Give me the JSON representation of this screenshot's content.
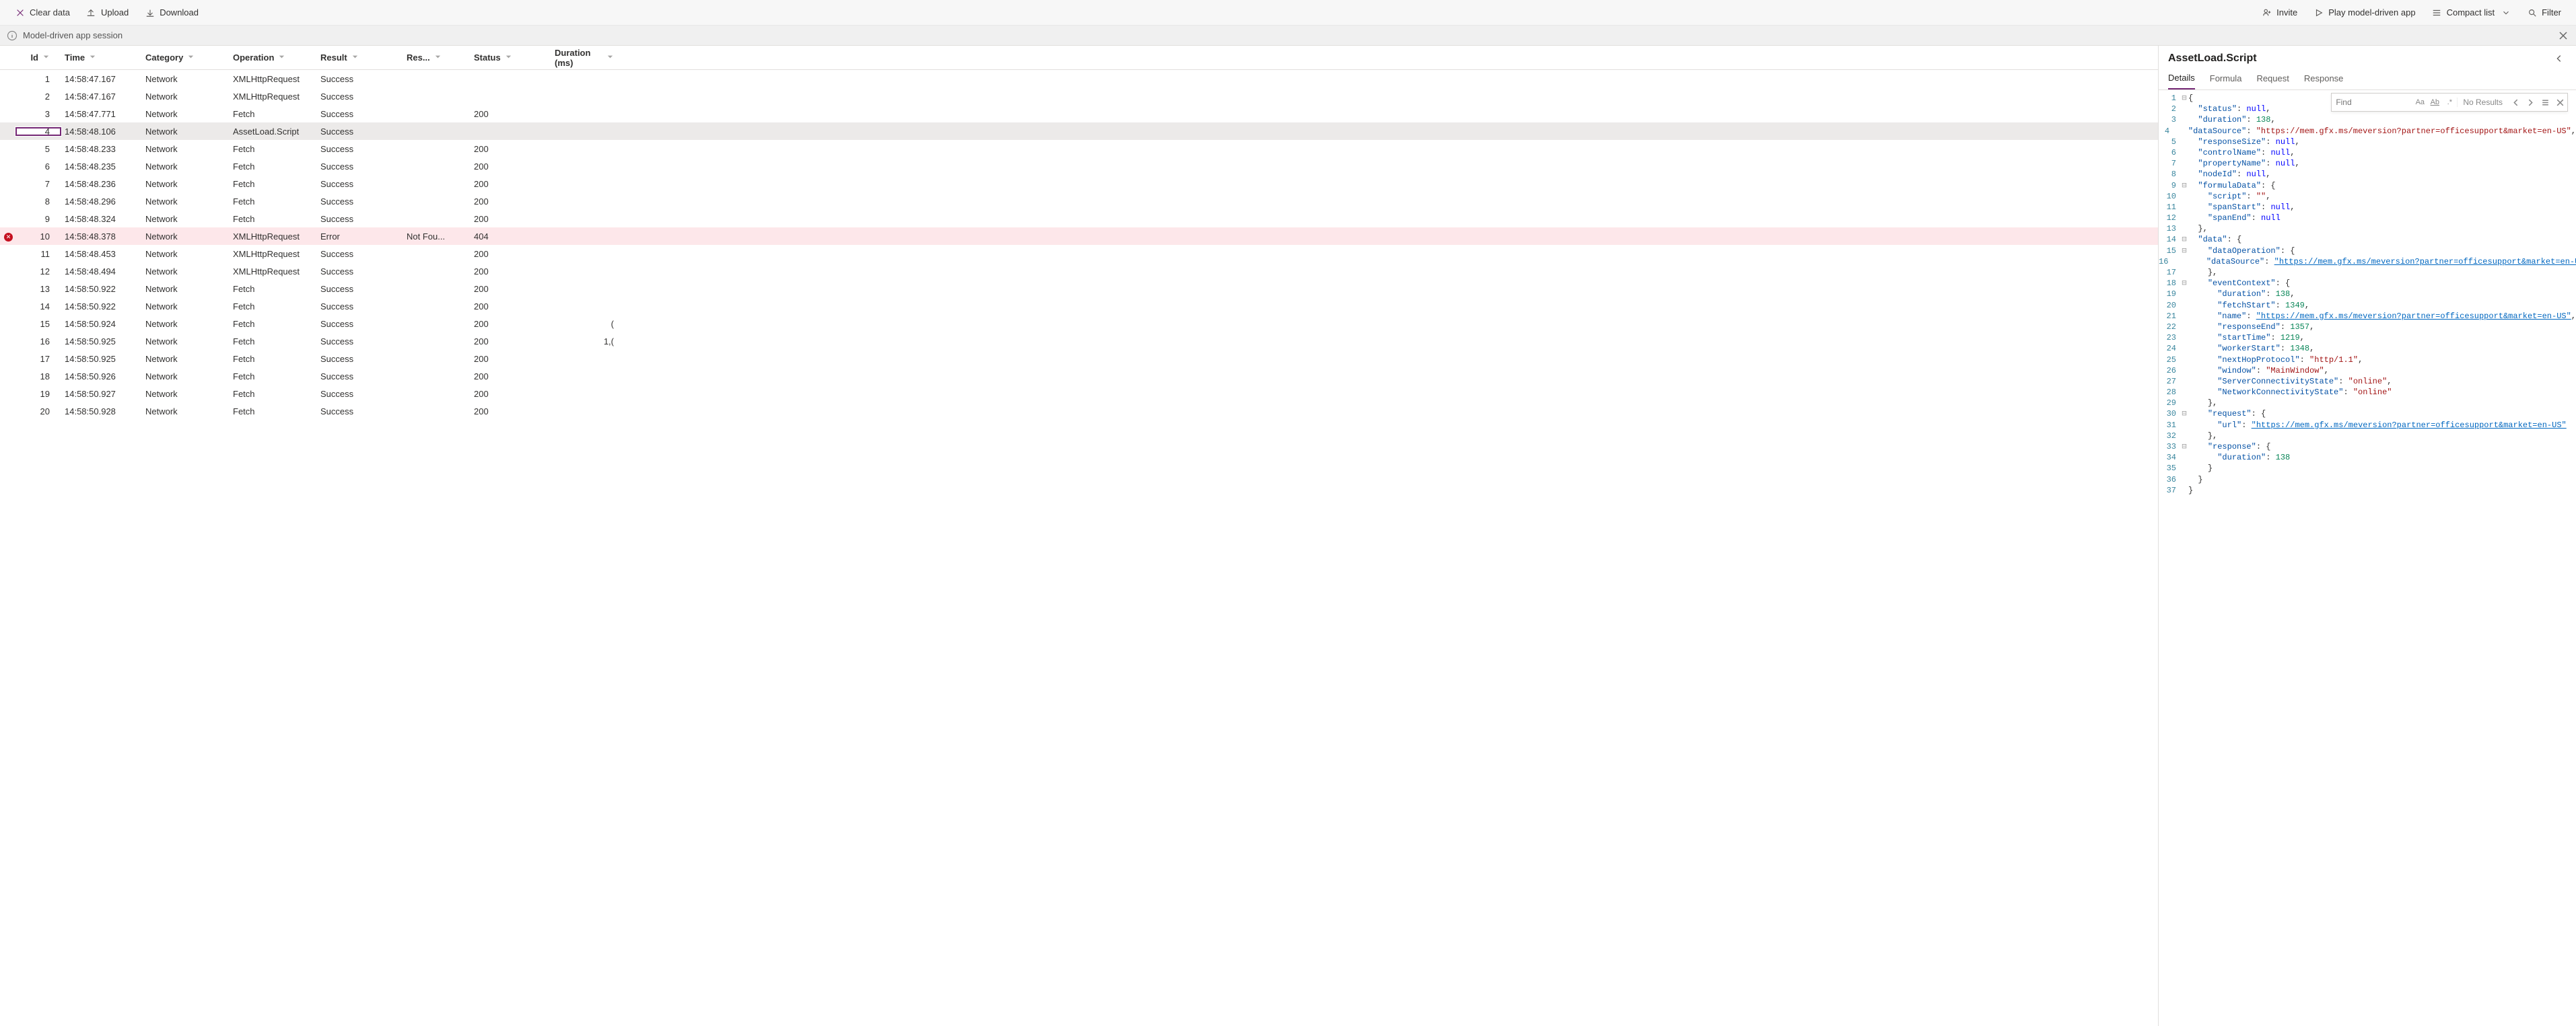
{
  "toolbar": {
    "clear": "Clear data",
    "upload": "Upload",
    "download": "Download",
    "invite": "Invite",
    "play": "Play model-driven app",
    "compact": "Compact list",
    "filter": "Filter"
  },
  "session": {
    "label": "Model-driven app session"
  },
  "grid": {
    "columns": {
      "id": "Id",
      "time": "Time",
      "category": "Category",
      "operation": "Operation",
      "result": "Result",
      "resShort": "Res...",
      "status": "Status",
      "duration": "Duration (ms)"
    },
    "rows": [
      {
        "id": "1",
        "time": "14:58:47.167",
        "category": "Network",
        "operation": "XMLHttpRequest",
        "result": "Success",
        "res": "",
        "status": "",
        "dur": "",
        "err": false,
        "sel": false
      },
      {
        "id": "2",
        "time": "14:58:47.167",
        "category": "Network",
        "operation": "XMLHttpRequest",
        "result": "Success",
        "res": "",
        "status": "",
        "dur": "",
        "err": false,
        "sel": false
      },
      {
        "id": "3",
        "time": "14:58:47.771",
        "category": "Network",
        "operation": "Fetch",
        "result": "Success",
        "res": "",
        "status": "200",
        "dur": "",
        "err": false,
        "sel": false
      },
      {
        "id": "4",
        "time": "14:58:48.106",
        "category": "Network",
        "operation": "AssetLoad.Script",
        "result": "Success",
        "res": "",
        "status": "",
        "dur": "",
        "err": false,
        "sel": true
      },
      {
        "id": "5",
        "time": "14:58:48.233",
        "category": "Network",
        "operation": "Fetch",
        "result": "Success",
        "res": "",
        "status": "200",
        "dur": "",
        "err": false,
        "sel": false
      },
      {
        "id": "6",
        "time": "14:58:48.235",
        "category": "Network",
        "operation": "Fetch",
        "result": "Success",
        "res": "",
        "status": "200",
        "dur": "",
        "err": false,
        "sel": false
      },
      {
        "id": "7",
        "time": "14:58:48.236",
        "category": "Network",
        "operation": "Fetch",
        "result": "Success",
        "res": "",
        "status": "200",
        "dur": "",
        "err": false,
        "sel": false
      },
      {
        "id": "8",
        "time": "14:58:48.296",
        "category": "Network",
        "operation": "Fetch",
        "result": "Success",
        "res": "",
        "status": "200",
        "dur": "",
        "err": false,
        "sel": false
      },
      {
        "id": "9",
        "time": "14:58:48.324",
        "category": "Network",
        "operation": "Fetch",
        "result": "Success",
        "res": "",
        "status": "200",
        "dur": "",
        "err": false,
        "sel": false
      },
      {
        "id": "10",
        "time": "14:58:48.378",
        "category": "Network",
        "operation": "XMLHttpRequest",
        "result": "Error",
        "res": "Not Fou...",
        "status": "404",
        "dur": "",
        "err": true,
        "sel": false
      },
      {
        "id": "11",
        "time": "14:58:48.453",
        "category": "Network",
        "operation": "XMLHttpRequest",
        "result": "Success",
        "res": "",
        "status": "200",
        "dur": "",
        "err": false,
        "sel": false
      },
      {
        "id": "12",
        "time": "14:58:48.494",
        "category": "Network",
        "operation": "XMLHttpRequest",
        "result": "Success",
        "res": "",
        "status": "200",
        "dur": "",
        "err": false,
        "sel": false
      },
      {
        "id": "13",
        "time": "14:58:50.922",
        "category": "Network",
        "operation": "Fetch",
        "result": "Success",
        "res": "",
        "status": "200",
        "dur": "",
        "err": false,
        "sel": false
      },
      {
        "id": "14",
        "time": "14:58:50.922",
        "category": "Network",
        "operation": "Fetch",
        "result": "Success",
        "res": "",
        "status": "200",
        "dur": "",
        "err": false,
        "sel": false
      },
      {
        "id": "15",
        "time": "14:58:50.924",
        "category": "Network",
        "operation": "Fetch",
        "result": "Success",
        "res": "",
        "status": "200",
        "dur": "(",
        "err": false,
        "sel": false
      },
      {
        "id": "16",
        "time": "14:58:50.925",
        "category": "Network",
        "operation": "Fetch",
        "result": "Success",
        "res": "",
        "status": "200",
        "dur": "1,(",
        "err": false,
        "sel": false
      },
      {
        "id": "17",
        "time": "14:58:50.925",
        "category": "Network",
        "operation": "Fetch",
        "result": "Success",
        "res": "",
        "status": "200",
        "dur": "",
        "err": false,
        "sel": false
      },
      {
        "id": "18",
        "time": "14:58:50.926",
        "category": "Network",
        "operation": "Fetch",
        "result": "Success",
        "res": "",
        "status": "200",
        "dur": "",
        "err": false,
        "sel": false
      },
      {
        "id": "19",
        "time": "14:58:50.927",
        "category": "Network",
        "operation": "Fetch",
        "result": "Success",
        "res": "",
        "status": "200",
        "dur": "",
        "err": false,
        "sel": false
      },
      {
        "id": "20",
        "time": "14:58:50.928",
        "category": "Network",
        "operation": "Fetch",
        "result": "Success",
        "res": "",
        "status": "200",
        "dur": "",
        "err": false,
        "sel": false
      }
    ]
  },
  "details": {
    "title": "AssetLoad.Script",
    "tabs": [
      "Details",
      "Formula",
      "Request",
      "Response"
    ],
    "activeTab": 0,
    "find": {
      "placeholder": "Find",
      "results": "No Results"
    },
    "code": [
      {
        "n": 1,
        "fold": "⊟",
        "i": 0,
        "t": [
          [
            "punc",
            "{"
          ]
        ]
      },
      {
        "n": 2,
        "fold": "",
        "i": 1,
        "t": [
          [
            "key",
            "\"status\""
          ],
          [
            "punc",
            ": "
          ],
          [
            "null",
            "null"
          ],
          [
            "punc",
            ","
          ]
        ]
      },
      {
        "n": 3,
        "fold": "",
        "i": 1,
        "t": [
          [
            "key",
            "\"duration\""
          ],
          [
            "punc",
            ": "
          ],
          [
            "num",
            "138"
          ],
          [
            "punc",
            ","
          ]
        ]
      },
      {
        "n": 4,
        "fold": "",
        "i": 1,
        "t": [
          [
            "key",
            "\"dataSource\""
          ],
          [
            "punc",
            ": "
          ],
          [
            "str",
            "\"https://mem.gfx.ms/meversion?partner=officesupport&market=en-US\""
          ],
          [
            "punc",
            ","
          ]
        ]
      },
      {
        "n": 5,
        "fold": "",
        "i": 1,
        "t": [
          [
            "key",
            "\"responseSize\""
          ],
          [
            "punc",
            ": "
          ],
          [
            "null",
            "null"
          ],
          [
            "punc",
            ","
          ]
        ]
      },
      {
        "n": 6,
        "fold": "",
        "i": 1,
        "t": [
          [
            "key",
            "\"controlName\""
          ],
          [
            "punc",
            ": "
          ],
          [
            "null",
            "null"
          ],
          [
            "punc",
            ","
          ]
        ]
      },
      {
        "n": 7,
        "fold": "",
        "i": 1,
        "t": [
          [
            "key",
            "\"propertyName\""
          ],
          [
            "punc",
            ": "
          ],
          [
            "null",
            "null"
          ],
          [
            "punc",
            ","
          ]
        ]
      },
      {
        "n": 8,
        "fold": "",
        "i": 1,
        "t": [
          [
            "key",
            "\"nodeId\""
          ],
          [
            "punc",
            ": "
          ],
          [
            "null",
            "null"
          ],
          [
            "punc",
            ","
          ]
        ]
      },
      {
        "n": 9,
        "fold": "⊟",
        "i": 1,
        "t": [
          [
            "key",
            "\"formulaData\""
          ],
          [
            "punc",
            ": {"
          ]
        ]
      },
      {
        "n": 10,
        "fold": "",
        "i": 2,
        "t": [
          [
            "key",
            "\"script\""
          ],
          [
            "punc",
            ": "
          ],
          [
            "str",
            "\"\""
          ],
          [
            "punc",
            ","
          ]
        ]
      },
      {
        "n": 11,
        "fold": "",
        "i": 2,
        "t": [
          [
            "key",
            "\"spanStart\""
          ],
          [
            "punc",
            ": "
          ],
          [
            "null",
            "null"
          ],
          [
            "punc",
            ","
          ]
        ]
      },
      {
        "n": 12,
        "fold": "",
        "i": 2,
        "t": [
          [
            "key",
            "\"spanEnd\""
          ],
          [
            "punc",
            ": "
          ],
          [
            "null",
            "null"
          ]
        ]
      },
      {
        "n": 13,
        "fold": "",
        "i": 1,
        "t": [
          [
            "punc",
            "},"
          ]
        ]
      },
      {
        "n": 14,
        "fold": "⊟",
        "i": 1,
        "t": [
          [
            "key",
            "\"data\""
          ],
          [
            "punc",
            ": {"
          ]
        ]
      },
      {
        "n": 15,
        "fold": "⊟",
        "i": 2,
        "t": [
          [
            "key",
            "\"dataOperation\""
          ],
          [
            "punc",
            ": {"
          ]
        ]
      },
      {
        "n": 16,
        "fold": "",
        "i": 3,
        "t": [
          [
            "key",
            "\"dataSource\""
          ],
          [
            "punc",
            ": "
          ],
          [
            "url",
            "\"https://mem.gfx.ms/meversion?partner=officesupport&market=en-US\""
          ]
        ]
      },
      {
        "n": 17,
        "fold": "",
        "i": 2,
        "t": [
          [
            "punc",
            "},"
          ]
        ]
      },
      {
        "n": 18,
        "fold": "⊟",
        "i": 2,
        "t": [
          [
            "key",
            "\"eventContext\""
          ],
          [
            "punc",
            ": {"
          ]
        ]
      },
      {
        "n": 19,
        "fold": "",
        "i": 3,
        "t": [
          [
            "key",
            "\"duration\""
          ],
          [
            "punc",
            ": "
          ],
          [
            "num",
            "138"
          ],
          [
            "punc",
            ","
          ]
        ]
      },
      {
        "n": 20,
        "fold": "",
        "i": 3,
        "t": [
          [
            "key",
            "\"fetchStart\""
          ],
          [
            "punc",
            ": "
          ],
          [
            "num",
            "1349"
          ],
          [
            "punc",
            ","
          ]
        ]
      },
      {
        "n": 21,
        "fold": "",
        "i": 3,
        "t": [
          [
            "key",
            "\"name\""
          ],
          [
            "punc",
            ": "
          ],
          [
            "url",
            "\"https://mem.gfx.ms/meversion?partner=officesupport&market=en-US\""
          ],
          [
            "punc",
            ","
          ]
        ]
      },
      {
        "n": 22,
        "fold": "",
        "i": 3,
        "t": [
          [
            "key",
            "\"responseEnd\""
          ],
          [
            "punc",
            ": "
          ],
          [
            "num",
            "1357"
          ],
          [
            "punc",
            ","
          ]
        ]
      },
      {
        "n": 23,
        "fold": "",
        "i": 3,
        "t": [
          [
            "key",
            "\"startTime\""
          ],
          [
            "punc",
            ": "
          ],
          [
            "num",
            "1219"
          ],
          [
            "punc",
            ","
          ]
        ]
      },
      {
        "n": 24,
        "fold": "",
        "i": 3,
        "t": [
          [
            "key",
            "\"workerStart\""
          ],
          [
            "punc",
            ": "
          ],
          [
            "num",
            "1348"
          ],
          [
            "punc",
            ","
          ]
        ]
      },
      {
        "n": 25,
        "fold": "",
        "i": 3,
        "t": [
          [
            "key",
            "\"nextHopProtocol\""
          ],
          [
            "punc",
            ": "
          ],
          [
            "str",
            "\"http/1.1\""
          ],
          [
            "punc",
            ","
          ]
        ]
      },
      {
        "n": 26,
        "fold": "",
        "i": 3,
        "t": [
          [
            "key",
            "\"window\""
          ],
          [
            "punc",
            ": "
          ],
          [
            "str",
            "\"MainWindow\""
          ],
          [
            "punc",
            ","
          ]
        ]
      },
      {
        "n": 27,
        "fold": "",
        "i": 3,
        "t": [
          [
            "key",
            "\"ServerConnectivityState\""
          ],
          [
            "punc",
            ": "
          ],
          [
            "str",
            "\"online\""
          ],
          [
            "punc",
            ","
          ]
        ]
      },
      {
        "n": 28,
        "fold": "",
        "i": 3,
        "t": [
          [
            "key",
            "\"NetworkConnectivityState\""
          ],
          [
            "punc",
            ": "
          ],
          [
            "str",
            "\"online\""
          ]
        ]
      },
      {
        "n": 29,
        "fold": "",
        "i": 2,
        "t": [
          [
            "punc",
            "},"
          ]
        ]
      },
      {
        "n": 30,
        "fold": "⊟",
        "i": 2,
        "t": [
          [
            "key",
            "\"request\""
          ],
          [
            "punc",
            ": {"
          ]
        ]
      },
      {
        "n": 31,
        "fold": "",
        "i": 3,
        "t": [
          [
            "key",
            "\"url\""
          ],
          [
            "punc",
            ": "
          ],
          [
            "url",
            "\"https://mem.gfx.ms/meversion?partner=officesupport&market=en-US\""
          ]
        ]
      },
      {
        "n": 32,
        "fold": "",
        "i": 2,
        "t": [
          [
            "punc",
            "},"
          ]
        ]
      },
      {
        "n": 33,
        "fold": "⊟",
        "i": 2,
        "t": [
          [
            "key",
            "\"response\""
          ],
          [
            "punc",
            ": {"
          ]
        ]
      },
      {
        "n": 34,
        "fold": "",
        "i": 3,
        "t": [
          [
            "key",
            "\"duration\""
          ],
          [
            "punc",
            ": "
          ],
          [
            "num",
            "138"
          ]
        ]
      },
      {
        "n": 35,
        "fold": "",
        "i": 2,
        "t": [
          [
            "punc",
            "}"
          ]
        ]
      },
      {
        "n": 36,
        "fold": "",
        "i": 1,
        "t": [
          [
            "punc",
            "}"
          ]
        ]
      },
      {
        "n": 37,
        "fold": "",
        "i": 0,
        "t": [
          [
            "punc",
            "}"
          ]
        ]
      }
    ]
  }
}
